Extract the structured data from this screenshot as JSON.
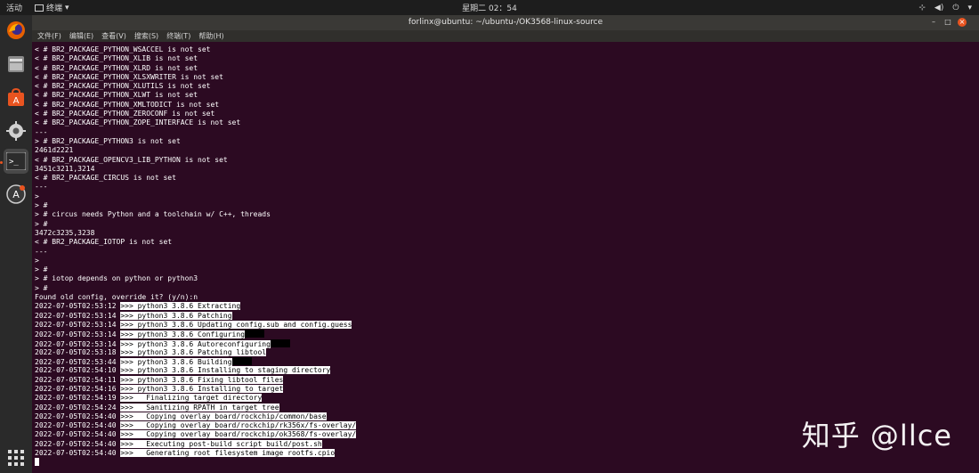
{
  "topbar": {
    "activities": "活动",
    "app_name": "终端",
    "clock": "星期二 02：54",
    "tray_network": "⊹",
    "tray_volume": "◀)",
    "tray_power": "⏻",
    "tray_menu": "▾"
  },
  "window": {
    "title": "forlinx@ubuntu: ~/ubuntu-/OK3568-linux-source",
    "menu": [
      "文件(F)",
      "编辑(E)",
      "查看(V)",
      "搜索(S)",
      "终端(T)",
      "帮助(H)"
    ],
    "close_glyph": "×",
    "minimize_glyph": "–"
  },
  "dock": [
    "firefox-icon",
    "files-icon",
    "software-center-icon",
    "settings-icon",
    "terminal-icon",
    "software-updater-icon",
    "show-apps-icon"
  ],
  "terminal": {
    "lines": [
      "< # BR2_PACKAGE_PYTHON_WSACCEL is not set",
      "< # BR2_PACKAGE_PYTHON_XLIB is not set",
      "< # BR2_PACKAGE_PYTHON_XLRD is not set",
      "< # BR2_PACKAGE_PYTHON_XLSXWRITER is not set",
      "< # BR2_PACKAGE_PYTHON_XLUTILS is not set",
      "< # BR2_PACKAGE_PYTHON_XLWT is not set",
      "< # BR2_PACKAGE_PYTHON_XMLTODICT is not set",
      "< # BR2_PACKAGE_PYTHON_ZEROCONF is not set",
      "< # BR2_PACKAGE_PYTHON_ZOPE_INTERFACE is not set",
      "---",
      "> # BR2_PACKAGE_PYTHON3 is not set",
      "2461d2221",
      "< # BR2_PACKAGE_OPENCV3_LIB_PYTHON is not set",
      "3451c3211,3214",
      "< # BR2_PACKAGE_CIRCUS is not set",
      "---",
      ">",
      "> #",
      "> # circus needs Python and a toolchain w/ C++, threads",
      "> #",
      "3472c3235,3238",
      "< # BR2_PACKAGE_IOTOP is not set",
      "---",
      ">",
      "> #",
      "> # iotop depends on python or python3",
      "> #",
      "Found old config, override it? (y/n):n"
    ],
    "build_lines": [
      {
        "ts": "2022-07-05T02:53:12",
        "msg": ">>> python3 3.8.6 Extracting"
      },
      {
        "ts": "2022-07-05T02:53:14",
        "msg": ">>> python3 3.8.6 Patching"
      },
      {
        "ts": "2022-07-05T02:53:14",
        "msg": ">>> python3 3.8.6 Updating config.sub and config.guess"
      },
      {
        "ts": "2022-07-05T02:53:14",
        "msg": ">>> python3 3.8.6 Configuring"
      },
      {
        "ts": "2022-07-05T02:53:14",
        "msg": ">>> python3 3.8.6 Autoreconfiguring"
      },
      {
        "ts": "2022-07-05T02:53:18",
        "msg": ">>> python3 3.8.6 Patching libtool"
      },
      {
        "ts": "2022-07-05T02:53:44",
        "msg": ">>> python3 3.8.6 Building"
      },
      {
        "ts": "2022-07-05T02:54:10",
        "msg": ">>> python3 3.8.6 Installing to staging directory"
      },
      {
        "ts": "2022-07-05T02:54:11",
        "msg": ">>> python3 3.8.6 Fixing libtool files"
      },
      {
        "ts": "2022-07-05T02:54:16",
        "msg": ">>> python3 3.8.6 Installing to target"
      },
      {
        "ts": "2022-07-05T02:54:19",
        "msg": ">>>   Finalizing target directory"
      },
      {
        "ts": "2022-07-05T02:54:24",
        "msg": ">>>   Sanitizing RPATH in target tree"
      },
      {
        "ts": "2022-07-05T02:54:40",
        "msg": ">>>   Copying overlay board/rockchip/common/base"
      },
      {
        "ts": "2022-07-05T02:54:40",
        "msg": ">>>   Copying overlay board/rockchip/rk356x/fs-overlay/"
      },
      {
        "ts": "2022-07-05T02:54:40",
        "msg": ">>>   Copying overlay board/rockchip/ok3568/fs-overlay/"
      },
      {
        "ts": "2022-07-05T02:54:40",
        "msg": ">>>   Executing post-build script build/post.sh"
      },
      {
        "ts": "2022-07-05T02:54:40",
        "msg": ">>>   Generating root filesystem image rootfs.cpio"
      }
    ],
    "black_block_rows": [
      3,
      4,
      6
    ]
  },
  "watermark": "知乎 @llce",
  "colors": {
    "terminal_bg": "#2c0a22",
    "highlight_bg": "#ffffff",
    "highlight_fg": "#000000",
    "accent": "#e95420"
  }
}
